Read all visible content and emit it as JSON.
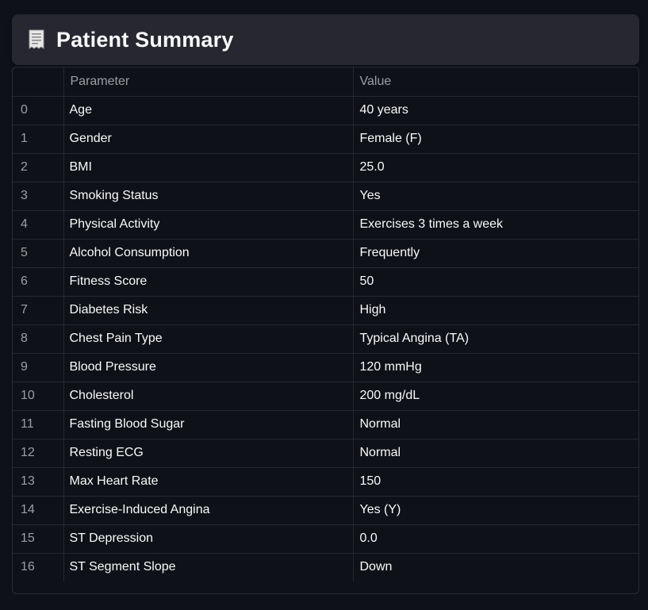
{
  "header": {
    "icon": "receipt-icon",
    "title": "Patient Summary"
  },
  "table": {
    "columns": [
      "",
      "Parameter",
      "Value"
    ],
    "rows": [
      {
        "index": "0",
        "parameter": "Age",
        "value": "40 years"
      },
      {
        "index": "1",
        "parameter": "Gender",
        "value": "Female (F)"
      },
      {
        "index": "2",
        "parameter": "BMI",
        "value": "25.0"
      },
      {
        "index": "3",
        "parameter": "Smoking Status",
        "value": "Yes"
      },
      {
        "index": "4",
        "parameter": "Physical Activity",
        "value": "Exercises 3 times a week"
      },
      {
        "index": "5",
        "parameter": "Alcohol Consumption",
        "value": "Frequently"
      },
      {
        "index": "6",
        "parameter": "Fitness Score",
        "value": "50"
      },
      {
        "index": "7",
        "parameter": "Diabetes Risk",
        "value": "High"
      },
      {
        "index": "8",
        "parameter": "Chest Pain Type",
        "value": "Typical Angina (TA)"
      },
      {
        "index": "9",
        "parameter": "Blood Pressure",
        "value": "120 mmHg"
      },
      {
        "index": "10",
        "parameter": "Cholesterol",
        "value": "200 mg/dL"
      },
      {
        "index": "11",
        "parameter": "Fasting Blood Sugar",
        "value": "Normal"
      },
      {
        "index": "12",
        "parameter": "Resting ECG",
        "value": "Normal"
      },
      {
        "index": "13",
        "parameter": "Max Heart Rate",
        "value": "150"
      },
      {
        "index": "14",
        "parameter": "Exercise-Induced Angina",
        "value": "Yes (Y)"
      },
      {
        "index": "15",
        "parameter": "ST Depression",
        "value": "0.0"
      },
      {
        "index": "16",
        "parameter": "ST Segment Slope",
        "value": "Down"
      }
    ]
  }
}
